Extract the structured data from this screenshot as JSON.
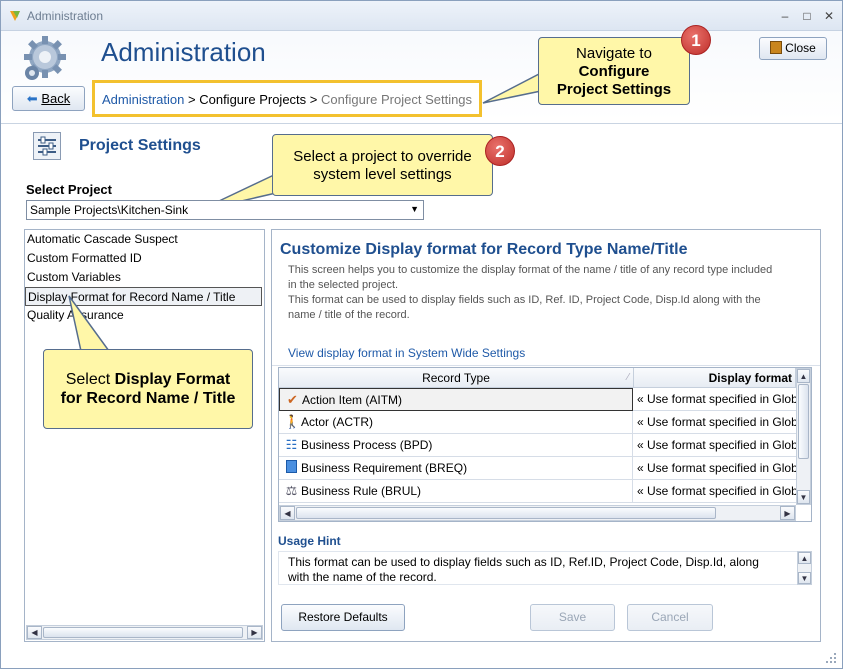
{
  "window": {
    "title": "Administration",
    "min": "–",
    "max": "□",
    "close": "✕"
  },
  "header": {
    "title": "Administration",
    "back_label": "Back",
    "close_label": "Close"
  },
  "breadcrumb": {
    "item1": "Administration",
    "sep": ">",
    "item2": "Configure Projects",
    "item3": "Configure Project Settings"
  },
  "callouts": {
    "c1": {
      "badge": "1",
      "line1": "Navigate to",
      "line2": "Configure",
      "line3": "Project Settings"
    },
    "c2": {
      "badge": "2",
      "line1": "Select a project to override",
      "line2": "system level settings"
    },
    "c3": {
      "line1_pre": "Select ",
      "line1_bold": "Display Format",
      "line2": "for Record Name / Title"
    }
  },
  "project_settings": {
    "title": "Project Settings",
    "select_label": "Select Project",
    "selected_project": "Sample Projects\\Kitchen-Sink"
  },
  "settings_list": [
    {
      "label": "Automatic Cascade Suspect"
    },
    {
      "label": "Custom Formatted ID"
    },
    {
      "label": "Custom Variables"
    },
    {
      "label": "Display Format for Record Name / Title"
    },
    {
      "label": "Quality Assurance"
    }
  ],
  "customize": {
    "title": "Customize Display format for Record Type Name/Title",
    "desc1": "This screen helps you to customize the display format of the name / title of any record type included",
    "desc2": "in the selected project.",
    "desc3": "This format can be used to display fields such as ID, Ref. ID, Project Code, Disp.Id along with the",
    "desc4": "name / title of the record.",
    "link": "View display format in System Wide Settings"
  },
  "grid": {
    "col1": "Record Type",
    "col2": "Display format",
    "rows": [
      {
        "type": "Action Item (AITM)",
        "format": "« Use format specified in Global",
        "icon": "action-item-icon"
      },
      {
        "type": "Actor (ACTR)",
        "format": "« Use format specified in Global",
        "icon": "actor-icon"
      },
      {
        "type": "Business Process (BPD)",
        "format": "« Use format specified in Global",
        "icon": "business-process-icon"
      },
      {
        "type": "Business Requirement (BREQ)",
        "format": "« Use format specified in Global",
        "icon": "requirement-icon"
      },
      {
        "type": "Business Rule (BRUL)",
        "format": "« Use format specified in Global",
        "icon": "business-rule-icon"
      }
    ]
  },
  "hint": {
    "title": "Usage Hint",
    "line1": "This format can be used to display fields such as ID, Ref.ID, Project Code, Disp.Id, along",
    "line2": "with the name of the record."
  },
  "buttons": {
    "restore": "Restore Defaults",
    "save": "Save",
    "cancel": "Cancel"
  },
  "colors": {
    "accent": "#1f4f8f",
    "callout": "#fff7a8",
    "highlight": "#f3c12e",
    "badge": "#c9342e"
  }
}
